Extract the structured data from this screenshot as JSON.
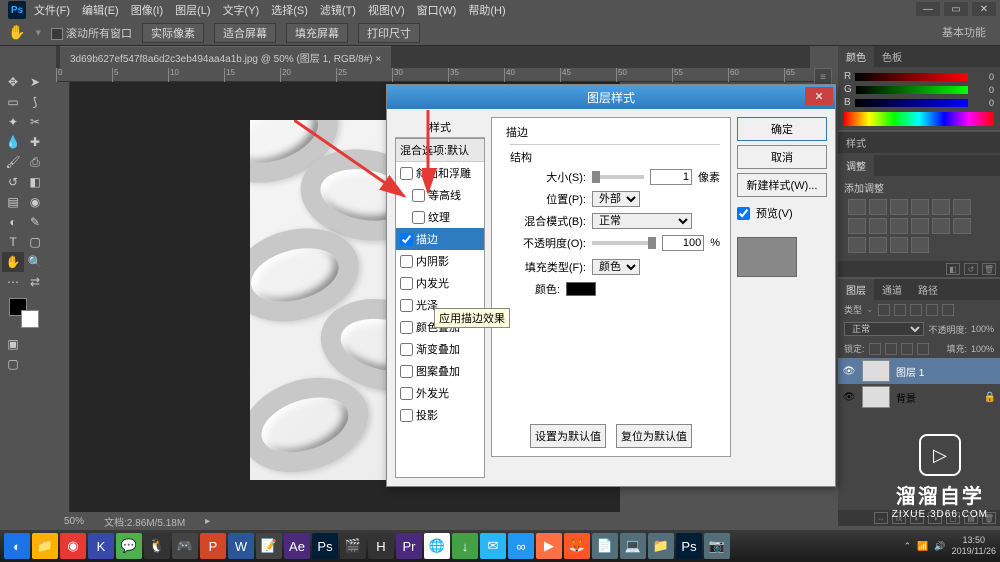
{
  "app": {
    "logo": "Ps"
  },
  "menu": [
    "文件(F)",
    "编辑(E)",
    "图像(I)",
    "图层(L)",
    "文字(Y)",
    "选择(S)",
    "滤镜(T)",
    "视图(V)",
    "窗口(W)",
    "帮助(H)"
  ],
  "win_btns": [
    "—",
    "▭",
    "✕"
  ],
  "base_func": "基本功能",
  "options": {
    "scroll_all": "滚动所有窗口",
    "btns": [
      "实际像素",
      "适合屏幕",
      "填充屏幕",
      "打印尺寸"
    ]
  },
  "doc_tab": "3d69b627ef547f8a6d2c3eb494aa4a1b.jpg @ 50% (图层 1, RGB/8#) ×",
  "ruler_marks": [
    "0",
    "5",
    "10",
    "15",
    "20",
    "25",
    "30",
    "35",
    "40",
    "45",
    "50",
    "55",
    "60",
    "65"
  ],
  "status": {
    "zoom": "50%",
    "docinfo": "文档:2.86M/5.18M"
  },
  "panels": {
    "color": {
      "tabs": [
        "颜色",
        "色板"
      ],
      "channels": [
        "R",
        "G",
        "B"
      ],
      "vals": [
        "0",
        "0",
        "0"
      ]
    },
    "styles": {
      "tabs": [
        "样式"
      ]
    },
    "adjust": {
      "tabs": [
        "调整"
      ],
      "title": "添加调整"
    },
    "layers": {
      "tabs": [
        "图层",
        "通道",
        "路径"
      ],
      "kind": "类型",
      "blend": "正常",
      "opacity_label": "不透明度:",
      "opacity": "100%",
      "lock_label": "锁定:",
      "fill_label": "填充:",
      "fill": "100%",
      "rows": [
        {
          "name": "图层 1",
          "selected": true,
          "locked": false
        },
        {
          "name": "背景",
          "selected": false,
          "locked": true
        }
      ]
    }
  },
  "dialog": {
    "title": "图层样式",
    "close": "✕",
    "styles_header": "样式",
    "blend_default": "混合选项:默认",
    "style_items": [
      {
        "key": "bevel",
        "label": "斜面和浮雕",
        "checked": false
      },
      {
        "key": "contour",
        "label": "等高线",
        "checked": false,
        "indent": true
      },
      {
        "key": "texture",
        "label": "纹理",
        "checked": false,
        "indent": true
      },
      {
        "key": "stroke",
        "label": "描边",
        "checked": true,
        "selected": true
      },
      {
        "key": "innershadow",
        "label": "内阴影",
        "checked": false
      },
      {
        "key": "innerglow",
        "label": "内发光",
        "checked": false
      },
      {
        "key": "satin",
        "label": "光泽",
        "checked": false
      },
      {
        "key": "coloroverlay",
        "label": "颜色叠加",
        "checked": false
      },
      {
        "key": "gradoverlay",
        "label": "渐变叠加",
        "checked": false
      },
      {
        "key": "pattoverlay",
        "label": "图案叠加",
        "checked": false
      },
      {
        "key": "outerglow",
        "label": "外发光",
        "checked": false
      },
      {
        "key": "dropshadow",
        "label": "投影",
        "checked": false
      }
    ],
    "tooltip": "应用描边效果",
    "section": "描边",
    "structure": "结构",
    "size_label": "大小(S):",
    "size_val": "1",
    "size_unit": "像素",
    "position_label": "位置(P):",
    "position_val": "外部",
    "blend_label": "混合模式(B):",
    "blend_val": "正常",
    "opacity_label": "不透明度(O):",
    "opacity_val": "100",
    "opacity_unit": "%",
    "filltype_label": "填充类型(F):",
    "filltype_val": "颜色",
    "color_label": "颜色:",
    "set_default": "设置为默认值",
    "reset_default": "复位为默认值",
    "ok": "确定",
    "cancel": "取消",
    "new_style": "新建样式(W)...",
    "preview": "预览(V)"
  },
  "taskbar": {
    "icons": [
      {
        "bg": "#1a73e8",
        "t": "◐"
      },
      {
        "bg": "#ffb000",
        "t": "📁"
      },
      {
        "bg": "#e53935",
        "t": "◉"
      },
      {
        "bg": "#3949ab",
        "t": "K"
      },
      {
        "bg": "#4caf50",
        "t": "💬"
      },
      {
        "bg": "#333",
        "t": "🐧"
      },
      {
        "bg": "#444",
        "t": "🎮"
      },
      {
        "bg": "#d24726",
        "t": "P"
      },
      {
        "bg": "#2b579a",
        "t": "W"
      },
      {
        "bg": "#444",
        "t": "📝"
      },
      {
        "bg": "#4b2a7b",
        "t": "Ae"
      },
      {
        "bg": "#001e36",
        "t": "Ps"
      },
      {
        "bg": "#333",
        "t": "🎬"
      },
      {
        "bg": "#333",
        "t": "H"
      },
      {
        "bg": "#4b2a7b",
        "t": "Pr"
      },
      {
        "bg": "#fff",
        "t": "🌐"
      },
      {
        "bg": "#43a047",
        "t": "↓"
      },
      {
        "bg": "#29b6f6",
        "t": "✉"
      },
      {
        "bg": "#2196f3",
        "t": "∞"
      },
      {
        "bg": "#ff7043",
        "t": "▶"
      },
      {
        "bg": "#ff5722",
        "t": "🦊"
      },
      {
        "bg": "#546e7a",
        "t": "📄"
      },
      {
        "bg": "#546e7a",
        "t": "💻"
      },
      {
        "bg": "#546e7a",
        "t": "📁"
      },
      {
        "bg": "#001e36",
        "t": "Ps"
      },
      {
        "bg": "#546e7a",
        "t": "📷"
      }
    ],
    "time": "13:50",
    "date": "2019/11/26"
  },
  "wm": {
    "line1": "溜溜自学",
    "line2": "ZIXUE.3D66.COM",
    "play": "▷"
  }
}
